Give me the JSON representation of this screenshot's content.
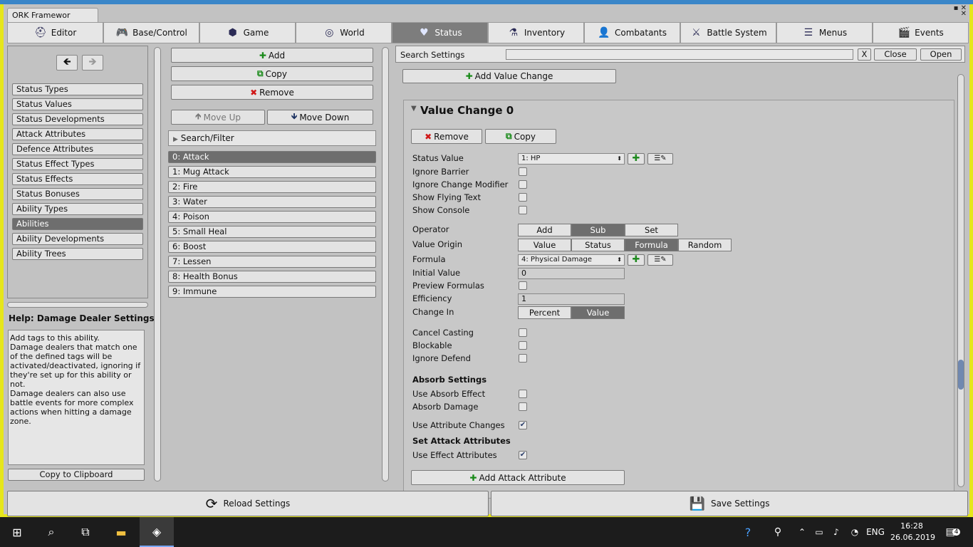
{
  "window": {
    "title": "ORK Framewor",
    "controls": "▪ ✕\n✕"
  },
  "tabs": [
    {
      "label": "Editor",
      "icon": "editor-icon",
      "glyph": "⛑"
    },
    {
      "label": "Base/Control",
      "icon": "gamepad-icon",
      "glyph": "🎮"
    },
    {
      "label": "Game",
      "icon": "cube-icon",
      "glyph": "⬢"
    },
    {
      "label": "World",
      "icon": "globe-icon",
      "glyph": "◎"
    },
    {
      "label": "Status",
      "icon": "heart-icon",
      "glyph": "♥"
    },
    {
      "label": "Inventory",
      "icon": "potion-icon",
      "glyph": "⚗"
    },
    {
      "label": "Combatants",
      "icon": "person-icon",
      "glyph": "👤"
    },
    {
      "label": "Battle System",
      "icon": "sword-icon",
      "glyph": "⚔"
    },
    {
      "label": "Menus",
      "icon": "menu-icon",
      "glyph": "☰"
    },
    {
      "label": "Events",
      "icon": "clapper-icon",
      "glyph": "🎬"
    }
  ],
  "sidebar": {
    "back": "🡸",
    "forward": "🡺",
    "items": [
      "Status Types",
      "Status Values",
      "Status Developments",
      "Attack Attributes",
      "Defence Attributes",
      "Status Effect Types",
      "Status Effects",
      "Status Bonuses",
      "Ability Types",
      "Abilities",
      "Ability Developments",
      "Ability Trees"
    ],
    "help_title": "Help: Damage Dealer Settings",
    "help_text": "Add tags to this ability.\nDamage dealers that match one of the defined tags will be activated/deactivated, ignoring if they're set up for this ability or not.\nDamage dealers can also use battle events for more complex actions when hitting a damage zone.",
    "copy_clipboard": "Copy to Clipboard"
  },
  "middle": {
    "add": "Add",
    "copy": "Copy",
    "remove": "Remove",
    "move_up": "Move Up",
    "move_down": "Move Down",
    "search_filter": "Search/Filter",
    "items": [
      "0: Attack",
      "1: Mug Attack",
      "2: Fire",
      "3: Water",
      "4: Poison",
      "5: Small Heal",
      "6: Boost",
      "7: Lessen",
      "8: Health Bonus",
      "9: Immune"
    ]
  },
  "right": {
    "search_label": "Search Settings",
    "clear": "X",
    "close": "Close",
    "open": "Open",
    "add_value_change": "Add Value Change",
    "vc_title": "Value Change 0",
    "remove": "Remove",
    "copy": "Copy",
    "status_value_label": "Status Value",
    "status_value": "1: HP",
    "ignore_barrier": "Ignore Barrier",
    "ignore_change_modifier": "Ignore Change Modifier",
    "show_flying_text": "Show Flying Text",
    "show_console": "Show Console",
    "operator_label": "Operator",
    "operator": [
      "Add",
      "Sub",
      "Set"
    ],
    "value_origin_label": "Value Origin",
    "value_origin": [
      "Value",
      "Status",
      "Formula",
      "Random"
    ],
    "formula_label": "Formula",
    "formula": "4: Physical Damage",
    "initial_value_label": "Initial Value",
    "initial_value": "0",
    "preview_formulas": "Preview Formulas",
    "efficiency_label": "Efficiency",
    "efficiency": "1",
    "change_in_label": "Change In",
    "change_in": [
      "Percent",
      "Value"
    ],
    "cancel_casting": "Cancel Casting",
    "blockable": "Blockable",
    "ignore_defend": "Ignore Defend",
    "absorb_settings": "Absorb Settings",
    "use_absorb_effect": "Use Absorb Effect",
    "absorb_damage": "Absorb Damage",
    "use_attribute_changes": "Use Attribute Changes",
    "set_attack_attributes": "Set Attack Attributes",
    "use_effect_attributes": "Use Effect Attributes",
    "add_attack_attribute": "Add Attack Attribute",
    "check": "✔"
  },
  "bottom": {
    "reload": "Reload Settings",
    "save": "Save Settings"
  },
  "taskbar": {
    "lang": "ENG",
    "time": "16:28",
    "date": "26.06.2019",
    "notif": "4"
  }
}
